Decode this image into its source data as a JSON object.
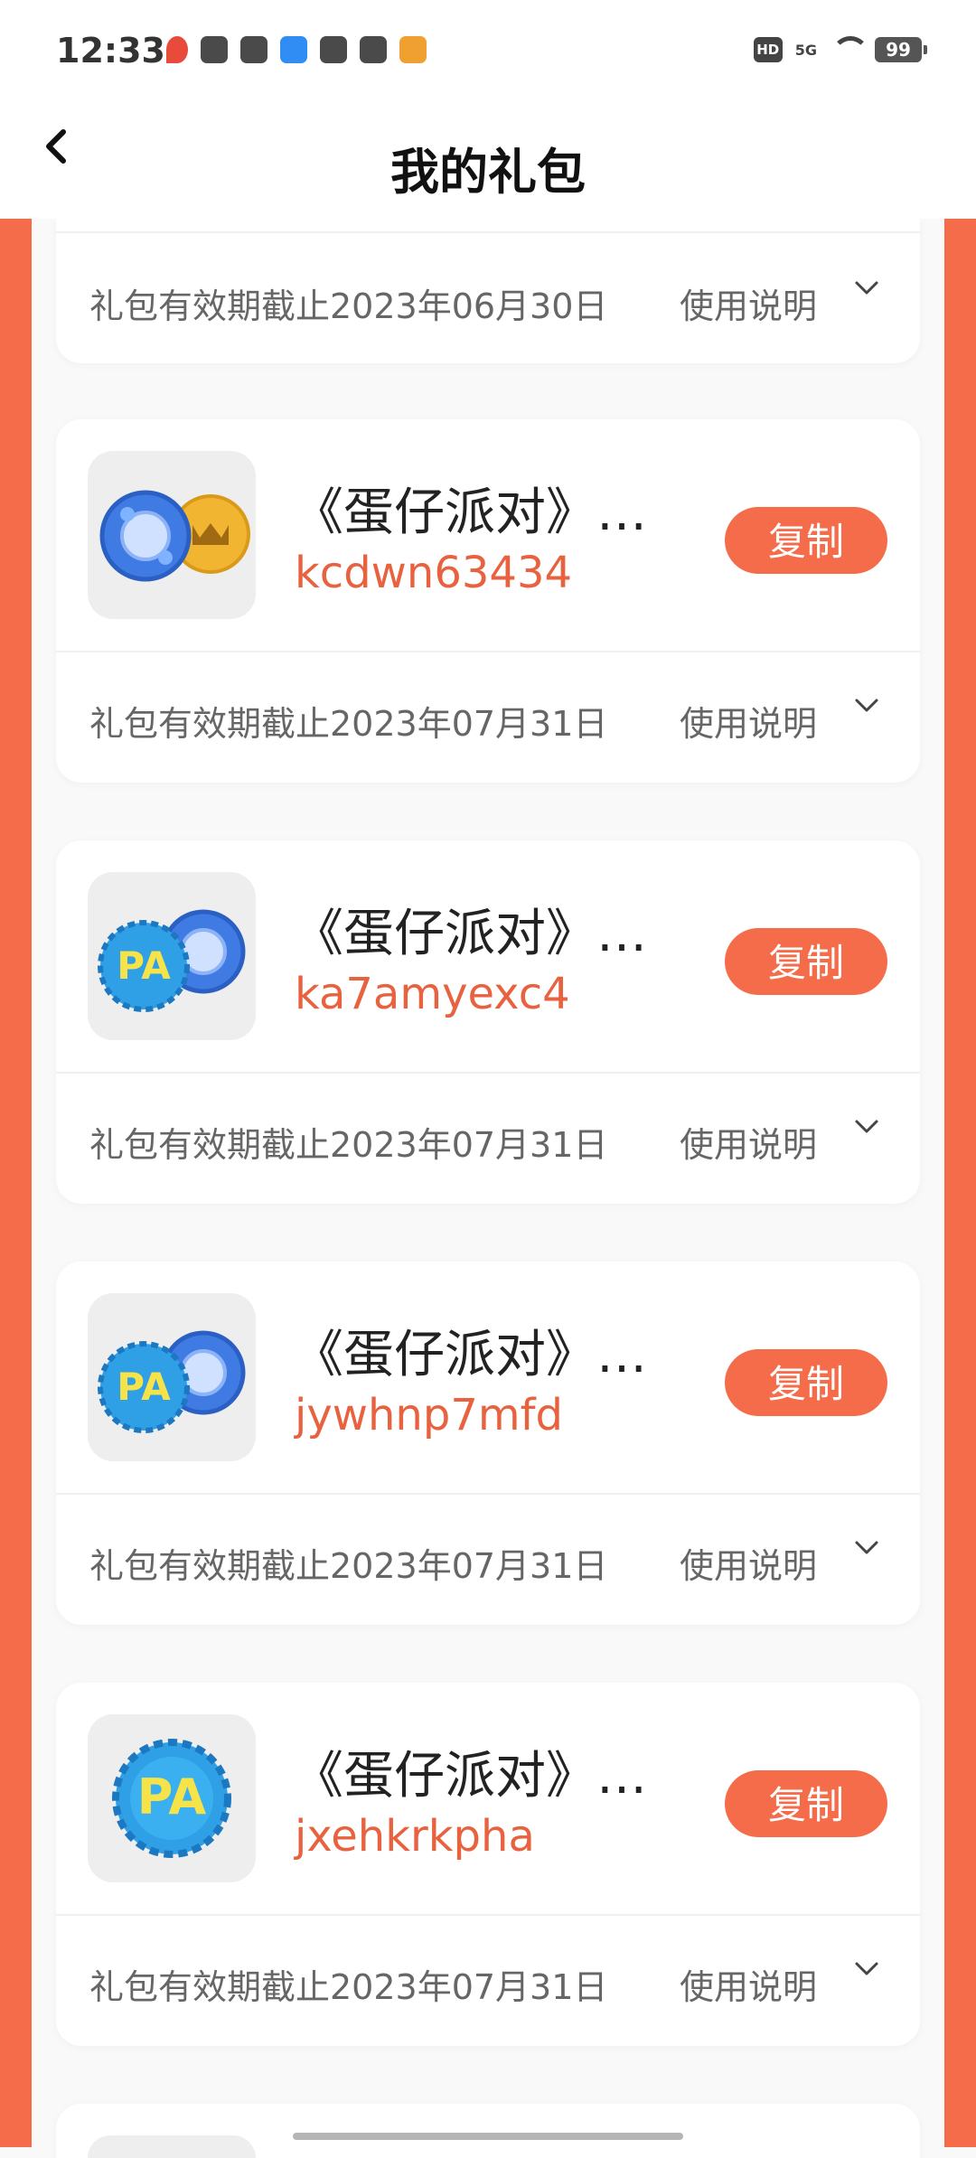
{
  "status_bar": {
    "time": "12:33",
    "network": "5G",
    "battery": "99",
    "hd": "HD"
  },
  "nav": {
    "title": "我的礼包",
    "back_icon": "chevron-left-icon"
  },
  "accent_color": "#f56c4a",
  "first_card_partial": {
    "expiry": "礼包有效期截止2023年06月30日",
    "usage_label": "使用说明"
  },
  "gifts": [
    {
      "game_name": "《蛋仔派对》…",
      "code": "kcdwn63434",
      "copy_label": "复制",
      "expiry": "礼包有效期截止2023年07月31日",
      "usage_label": "使用说明",
      "icon": "crystal-and-crown-coins-icon"
    },
    {
      "game_name": "《蛋仔派对》…",
      "code": "ka7amyexc4",
      "copy_label": "复制",
      "expiry": "礼包有效期截止2023年07月31日",
      "usage_label": "使用说明",
      "icon": "bottle-cap-and-crystal-icon"
    },
    {
      "game_name": "《蛋仔派对》…",
      "code": "jywhnp7mfd",
      "copy_label": "复制",
      "expiry": "礼包有效期截止2023年07月31日",
      "usage_label": "使用说明",
      "icon": "bottle-cap-and-crystal-icon"
    },
    {
      "game_name": "《蛋仔派对》…",
      "code": "jxehkrkpha",
      "copy_label": "复制",
      "expiry": "礼包有效期截止2023年07月31日",
      "usage_label": "使用说明",
      "icon": "bottle-cap-icon"
    }
  ]
}
